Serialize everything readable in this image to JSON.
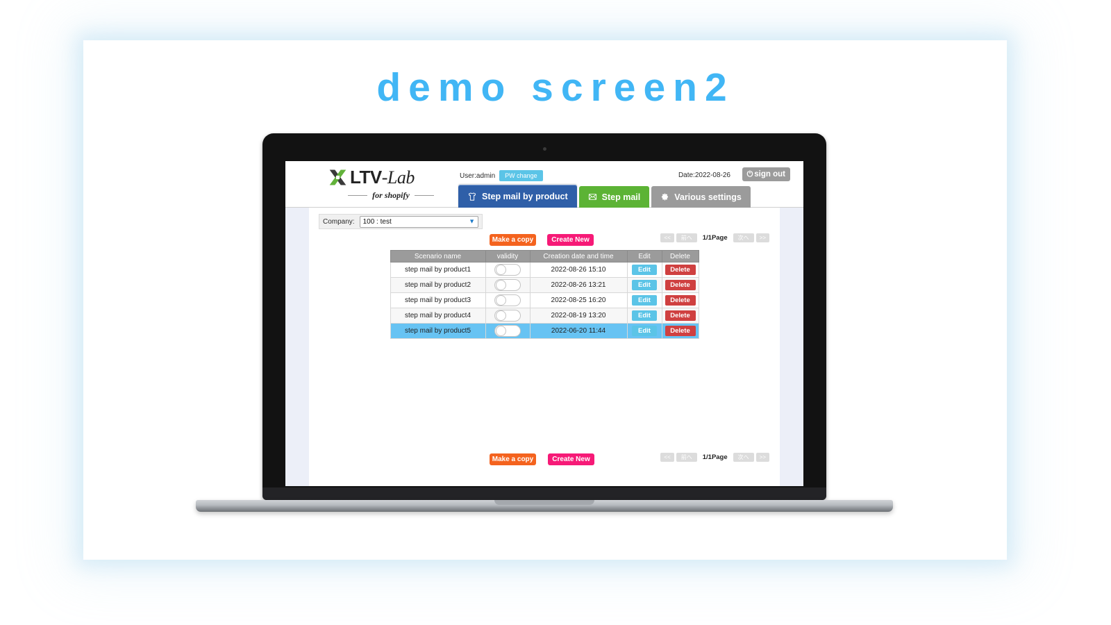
{
  "page": {
    "title": "demo screen2",
    "title_color": "#41b6f5"
  },
  "app": {
    "brand": {
      "name_main": "LTV",
      "name_sep": "-",
      "name_italic": "Lab",
      "tagline": "for shopify",
      "mark_icon": "x-mark-icon",
      "mark_color_green": "#62b23a",
      "mark_color_dark": "#3a3a3a"
    },
    "header": {
      "user_label": "User:admin",
      "pw_change_label": "PW change",
      "pw_change_color": "#5bc4e7",
      "date_label": "Date:2022-08-26",
      "signout_label": "sign out",
      "signout_icon": "power-icon",
      "signout_color": "#9b9b9b"
    },
    "tabs": [
      {
        "label": "Step mail by product",
        "icon": "tshirt-icon",
        "color": "#2f5fa8",
        "active": true
      },
      {
        "label": "Step mail",
        "icon": "envelope-icon",
        "color": "#5cb335",
        "active": false
      },
      {
        "label": "Various settings",
        "icon": "gear-icon",
        "color": "#9b9b9b",
        "active": false
      }
    ],
    "company": {
      "label": "Company:",
      "selected": "100 : test",
      "caret_icon": "chevron-down-icon"
    },
    "toolbar": {
      "make_copy_label": "Make a copy",
      "make_copy_color": "#f4631e",
      "create_new_label": "Create New",
      "create_new_color": "#f61a77"
    },
    "pagination": {
      "first_label": "<<",
      "prev_label": "前へ",
      "page_label": "1/1Page",
      "next_label": "次へ",
      "last_label": ">>"
    },
    "table": {
      "columns": [
        "Scenario name",
        "validity",
        "Creation date and time",
        "Edit",
        "Delete"
      ],
      "edit_label": "Edit",
      "delete_label": "Delete",
      "edit_color": "#5bc4e7",
      "delete_color": "#cf4040",
      "selected_row_color": "#67c3f3",
      "rows": [
        {
          "name": "step mail by product1",
          "validity": false,
          "created": "2022-08-26 15:10",
          "selected": false
        },
        {
          "name": "step mail by product2",
          "validity": false,
          "created": "2022-08-26 13:21",
          "selected": false
        },
        {
          "name": "step mail by product3",
          "validity": false,
          "created": "2022-08-25 16:20",
          "selected": false
        },
        {
          "name": "step mail by product4",
          "validity": false,
          "created": "2022-08-19 13:20",
          "selected": false
        },
        {
          "name": "step mail by product5",
          "validity": false,
          "created": "2022-06-20 11:44",
          "selected": true
        }
      ]
    }
  }
}
